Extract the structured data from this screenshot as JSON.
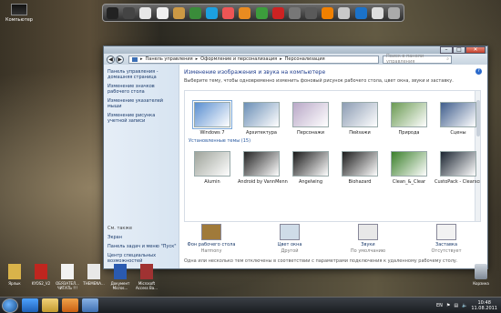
{
  "desktop": {
    "computer_label": "Компьютер",
    "trash_label": "Корзина",
    "icons": [
      {
        "label": "Ярлык",
        "color": "#d9b34a"
      },
      {
        "label": "KYOS2_V2",
        "color": "#c0261f"
      },
      {
        "label": "ОБЯЗАТЕЛ... ЧИТАТЬ !!!",
        "color": "#f2f2f2"
      },
      {
        "label": "THEMENA...",
        "color": "#e8e8e8"
      },
      {
        "label": "Документ Micros...",
        "color": "#2a5ab0"
      },
      {
        "label": "Microsoft Access Ba...",
        "color": "#a03232"
      }
    ]
  },
  "window": {
    "address": {
      "root_icon": "control-panel-icon",
      "crumbs": [
        "Панель управления",
        "Оформление и персонализация",
        "Персонализация"
      ]
    },
    "search_placeholder": "Поиск в панели управления",
    "sidebar": {
      "links": [
        "Панель управления - домашняя страница",
        "Изменение значков рабочего стола",
        "Изменение указателей мыши",
        "Изменение рисунка учетной записи"
      ],
      "see_also": "См. также",
      "see_also_links": [
        "Экран",
        "Панель задач и меню \"Пуск\"",
        "Центр специальных возможностей"
      ]
    },
    "title": "Изменение изображения и звука на компьютере",
    "description": "Выберите тему, чтобы одновременно изменить фоновый рисунок рабочего стола, цвет окна, звуки и заставку.",
    "aero_themes": [
      {
        "name": "Windows 7",
        "color": "#5a8fd0"
      },
      {
        "name": "Архитектура",
        "color": "#6b8fb6"
      },
      {
        "name": "Персонажи",
        "color": "#b9a8c7"
      },
      {
        "name": "Пейзажи",
        "color": "#8c9cb3"
      },
      {
        "name": "Природа",
        "color": "#6a9a52"
      },
      {
        "name": "Сцены",
        "color": "#3f5d8c"
      }
    ],
    "installed_label": "Установленные темы (15)",
    "installed_themes": [
      {
        "name": "Alumin",
        "color": "#9ea39a"
      },
      {
        "name": "Android by VannMenn",
        "color": "#222"
      },
      {
        "name": "Angelwing",
        "color": "#181818"
      },
      {
        "name": "Biohazard",
        "color": "#1b1b1b"
      },
      {
        "name": "Clean_&_Clear",
        "color": "#3a7f2a"
      },
      {
        "name": "CustoPack - Clearscreen Sharp",
        "color": "#1a2430"
      }
    ],
    "bottom": [
      {
        "label": "Фон рабочего стола",
        "sub": "Harmony",
        "icon": "desktop-background-icon"
      },
      {
        "label": "Цвет окна",
        "sub": "Другой",
        "icon": "window-color-icon"
      },
      {
        "label": "Звуки",
        "sub": "По умолчанию",
        "icon": "sounds-icon"
      },
      {
        "label": "Заставка",
        "sub": "Отсутствует",
        "icon": "screensaver-icon"
      }
    ],
    "note": "Одна или несколько тем отключены в соответствии с параметрами подключения к удаленному рабочему столу."
  },
  "taskbar": {
    "lang": "EN",
    "time": "10:48",
    "date": "11.08.2011"
  },
  "dock_icons": [
    "monitor-icon",
    "dark-icon",
    "toolbar-icon",
    "wrench-icon",
    "people-icon",
    "utorrent-icon",
    "skype-icon",
    "music-icon",
    "ring-icon",
    "chrome-icon",
    "opera-icon",
    "gear-icon",
    "camera-icon",
    "vlc-icon",
    "box-icon",
    "bars-icon",
    "play-icon",
    "app-icon"
  ]
}
